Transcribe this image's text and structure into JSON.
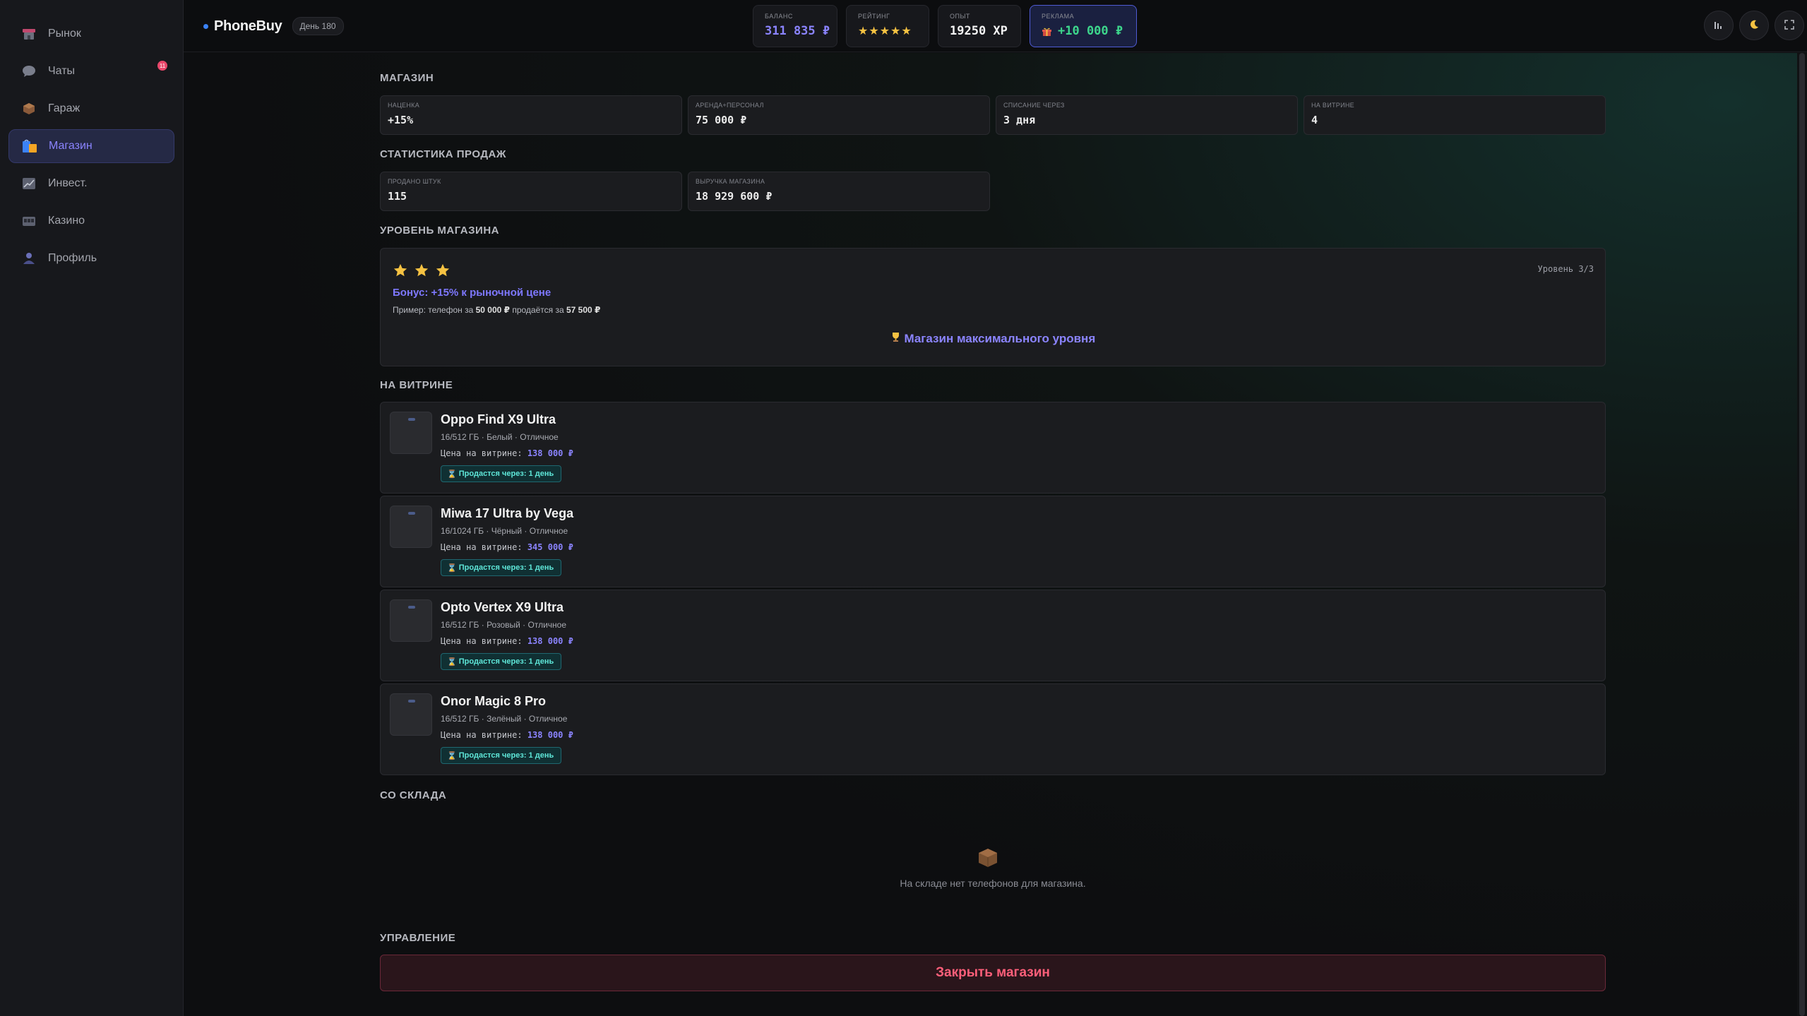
{
  "sidebar": {
    "items": [
      {
        "label": "Рынок",
        "icon": "market-icon"
      },
      {
        "label": "Чаты",
        "icon": "chat-icon",
        "badge": "11"
      },
      {
        "label": "Гараж",
        "icon": "garage-icon"
      },
      {
        "label": "Магазин",
        "icon": "shop-icon",
        "active": true
      },
      {
        "label": "Инвест.",
        "icon": "chart-icon"
      },
      {
        "label": "Казино",
        "icon": "casino-icon"
      },
      {
        "label": "Профиль",
        "icon": "profile-icon"
      }
    ]
  },
  "header": {
    "brand": "PhoneBuy",
    "day": "День 180",
    "balance": {
      "label": "БАЛАНС",
      "value": "311 835 ₽"
    },
    "rating": {
      "label": "РЕЙТИНГ",
      "value": "★★★★★"
    },
    "xp": {
      "label": "ОПЫТ",
      "value": "19250 XP"
    },
    "ads": {
      "label": "РЕКЛАМА",
      "value": "+10 000 ₽"
    }
  },
  "shop": {
    "title": "МАГАЗИН",
    "metrics": [
      {
        "label": "НАЦЕНКА",
        "value": "+15%"
      },
      {
        "label": "АРЕНДА+ПЕРСОНАЛ",
        "value": "75 000 ₽"
      },
      {
        "label": "СПИСАНИЕ ЧЕРЕЗ",
        "value": "3 дня"
      },
      {
        "label": "НА ВИТРИНЕ",
        "value": "4"
      }
    ]
  },
  "sales": {
    "title": "СТАТИСТИКА ПРОДАЖ",
    "metrics": [
      {
        "label": "ПРОДАНО ШТУК",
        "value": "115"
      },
      {
        "label": "ВЫРУЧКА МАГАЗИНА",
        "value": "18 929 600 ₽"
      }
    ]
  },
  "level": {
    "title": "УРОВЕНЬ МАГАЗИНА",
    "stars": 3,
    "level_text": "Уровень 3/3",
    "bonus": "Бонус: +15% к рыночной цене",
    "example_prefix": "Пример: телефон за",
    "example_from": "50 000 ₽",
    "example_mid": "продаётся за",
    "example_to": "57 500 ₽",
    "max_text": "Магазин максимального уровня"
  },
  "showcase": {
    "title": "НА ВИТРИНЕ",
    "price_label": "Цена на витрине:",
    "items": [
      {
        "name": "Oppo Find X9 Ultra",
        "spec": "16/512 ГБ · Белый · Отличное",
        "price": "138 000 ₽",
        "sell": "Продастся через: 1 день"
      },
      {
        "name": "Miwa 17 Ultra by Vega",
        "spec": "16/1024 ГБ · Чёрный · Отличное",
        "price": "345 000 ₽",
        "sell": "Продастся через: 1 день"
      },
      {
        "name": "Opto Vertex X9 Ultra",
        "spec": "16/512 ГБ · Розовый · Отличное",
        "price": "138 000 ₽",
        "sell": "Продастся через: 1 день"
      },
      {
        "name": "Onor Magic 8 Pro",
        "spec": "16/512 ГБ · Зелёный · Отличное",
        "price": "138 000 ₽",
        "sell": "Продастся через: 1 день"
      }
    ]
  },
  "warehouse": {
    "title": "СО СКЛАДА",
    "empty_text": "На складе нет телефонов для магазина."
  },
  "management": {
    "title": "УПРАВЛЕНИЕ",
    "close_label": "Закрыть магазин"
  }
}
